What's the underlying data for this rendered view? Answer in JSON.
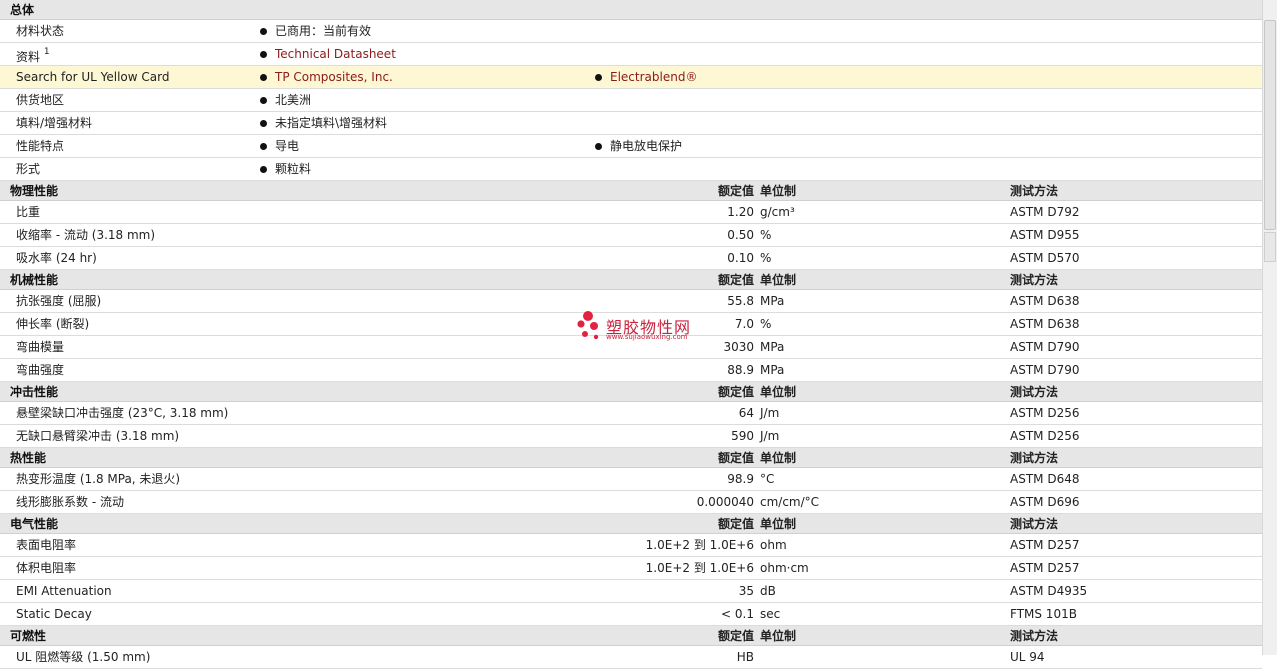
{
  "general": {
    "title": "总体",
    "rows": [
      {
        "label": "材料状态",
        "sup": "",
        "items": [
          "已商用：当前有效"
        ],
        "links": false,
        "highlight": false
      },
      {
        "label": "资料",
        "sup": "1",
        "items": [
          "Technical Datasheet"
        ],
        "links": true,
        "highlight": false
      },
      {
        "label": "Search for UL Yellow Card",
        "sup": "",
        "items": [
          "TP Composites, Inc.",
          "Electrablend®"
        ],
        "links": true,
        "highlight": true
      },
      {
        "label": "供货地区",
        "sup": "",
        "items": [
          "北美洲"
        ],
        "links": false,
        "highlight": false
      },
      {
        "label": "填料/增强材料",
        "sup": "",
        "items": [
          "未指定填料\\增强材料"
        ],
        "links": false,
        "highlight": false
      },
      {
        "label": "性能特点",
        "sup": "",
        "items": [
          "导电",
          "静电放电保护"
        ],
        "links": false,
        "highlight": false
      },
      {
        "label": "形式",
        "sup": "",
        "items": [
          "颗粒料"
        ],
        "links": false,
        "highlight": false
      }
    ]
  },
  "headers": {
    "value": "额定值",
    "unit": "单位制",
    "test": "测试方法"
  },
  "sections": [
    {
      "title": "物理性能",
      "rows": [
        {
          "prop": "比重",
          "value": "1.20",
          "unit": "g/cm³",
          "test": "ASTM D792"
        },
        {
          "prop": "收缩率  - 流动  (3.18 mm)",
          "value": "0.50",
          "unit": "%",
          "test": "ASTM D955"
        },
        {
          "prop": "吸水率  (24 hr)",
          "value": "0.10",
          "unit": "%",
          "test": "ASTM D570"
        }
      ]
    },
    {
      "title": "机械性能",
      "rows": [
        {
          "prop": "抗张强度  (屈服)",
          "value": "55.8",
          "unit": "MPa",
          "test": "ASTM D638"
        },
        {
          "prop": "伸长率  (断裂)",
          "value": "7.0",
          "unit": "%",
          "test": "ASTM D638"
        },
        {
          "prop": "弯曲模量",
          "value": "3030",
          "unit": "MPa",
          "test": "ASTM D790"
        },
        {
          "prop": "弯曲强度",
          "value": "88.9",
          "unit": "MPa",
          "test": "ASTM D790"
        }
      ]
    },
    {
      "title": "冲击性能",
      "rows": [
        {
          "prop": "悬壁梁缺口冲击强度  (23°C, 3.18 mm)",
          "value": "64",
          "unit": "J/m",
          "test": "ASTM D256"
        },
        {
          "prop": "无缺口悬臂梁冲击  (3.18 mm)",
          "value": "590",
          "unit": "J/m",
          "test": "ASTM D256"
        }
      ]
    },
    {
      "title": "热性能",
      "rows": [
        {
          "prop": "热变形温度  (1.8 MPa, 未退火)",
          "value": "98.9",
          "unit": "°C",
          "test": "ASTM D648"
        },
        {
          "prop": "线形膨胀系数  - 流动",
          "value": "0.000040",
          "unit": "cm/cm/°C",
          "test": "ASTM D696"
        }
      ]
    },
    {
      "title": "电气性能",
      "rows": [
        {
          "prop": "表面电阻率",
          "value": "1.0E+2 到  1.0E+6",
          "unit": "ohm",
          "test": "ASTM D257"
        },
        {
          "prop": "体积电阻率",
          "value": "1.0E+2 到  1.0E+6",
          "unit": "ohm·cm",
          "test": "ASTM D257"
        },
        {
          "prop": "EMI Attenuation",
          "value": "35",
          "unit": "dB",
          "test": "ASTM D4935"
        },
        {
          "prop": "Static Decay",
          "value": "< 0.1",
          "unit": "sec",
          "test": "FTMS 101B"
        }
      ]
    },
    {
      "title": "可燃性",
      "rows": [
        {
          "prop": "UL 阻燃等级  (1.50 mm)",
          "value": "HB",
          "unit": "",
          "test": "UL 94"
        }
      ]
    }
  ],
  "watermark": {
    "text": "塑胶物性网",
    "url": "www.sujiaowuxing.com"
  },
  "colors": {
    "link": "#8b1a1a",
    "highlight": "#fdf7d4",
    "section": "#e6e6e6",
    "watermark": "#c4122f"
  }
}
